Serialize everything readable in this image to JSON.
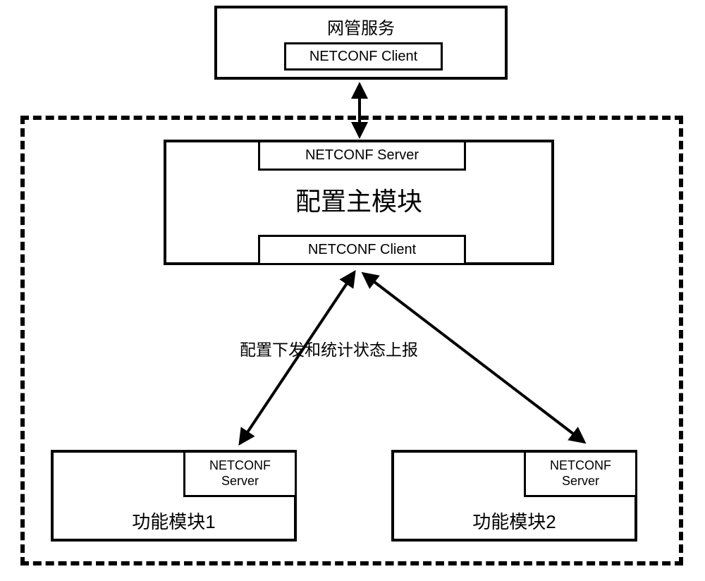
{
  "top_box": {
    "title": "网管服务",
    "client_label": "NETCONF Client"
  },
  "main_module": {
    "server_label": "NETCONF Server",
    "title": "配置主模块",
    "client_label": "NETCONF Client"
  },
  "arrow_label": "配置下发和统计状态上报",
  "func_module_1": {
    "server_label": "NETCONF\nServer",
    "title": "功能模块1"
  },
  "func_module_2": {
    "server_label": "NETCONF\nServer",
    "title": "功能模块2"
  }
}
